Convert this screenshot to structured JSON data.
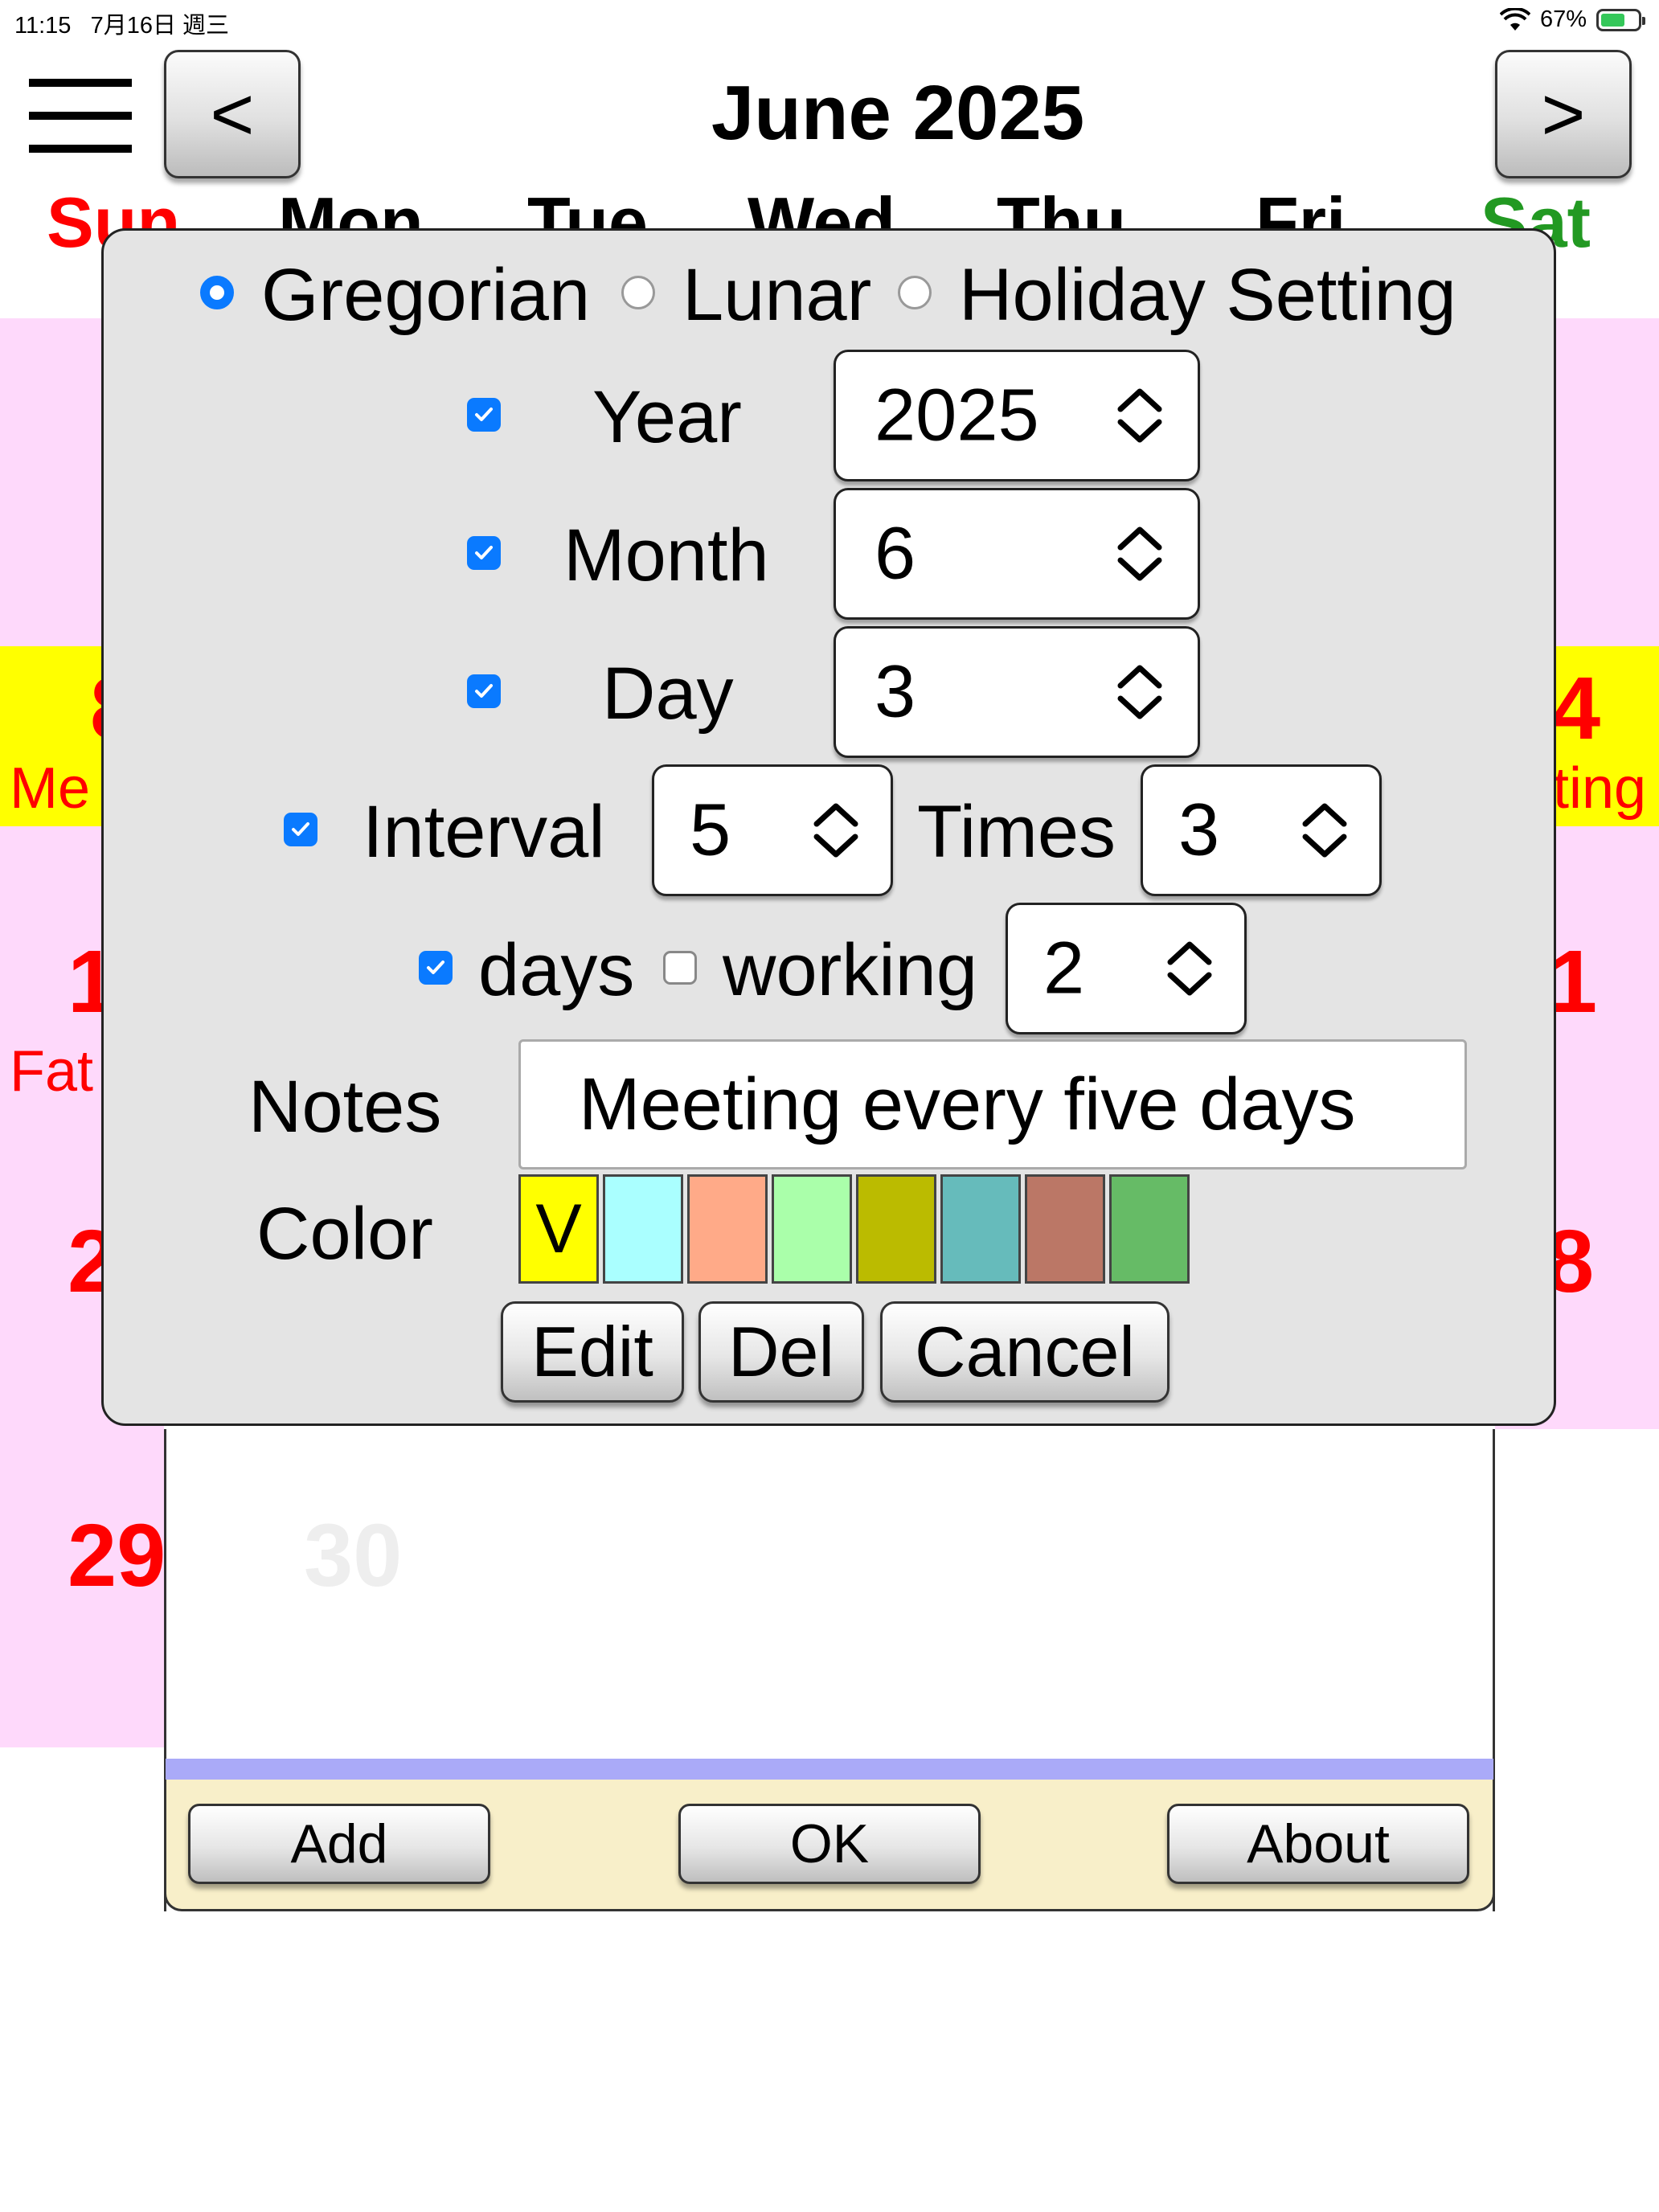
{
  "status_bar": {
    "time": "11:15",
    "date": "7月16日 週三",
    "battery": "67%"
  },
  "header": {
    "menu_icon": "hamburger-icon",
    "prev_label": "<",
    "next_label": ">",
    "title": "June 2025"
  },
  "weekdays": [
    "Sun",
    "Mon",
    "Tue",
    "Wed",
    "Thu",
    "Fri",
    "Sat"
  ],
  "calendar": {
    "row2_left_num": "8",
    "row2_left_text": "Me",
    "row2_right_num": "4",
    "row2_right_text": "ting",
    "row3_left_num": "1",
    "row3_left_text": "Fat",
    "row3_right_num": "1",
    "row4_left_num": "2",
    "row4_right_num": "8",
    "row5_sun": "29",
    "row5_mon": "30"
  },
  "dialog": {
    "mode_options": [
      "Gregorian",
      "Lunar",
      "Holiday Setting"
    ],
    "mode_selected": "Gregorian",
    "year_label": "Year",
    "year_value": "2025",
    "month_label": "Month",
    "month_value": "6",
    "day_label": "Day",
    "day_value": "3",
    "interval_label": "Interval",
    "interval_value": "5",
    "times_label": "Times",
    "times_value": "3",
    "days_label": "days",
    "working_label": "working",
    "working_value": "2",
    "notes_label": "Notes",
    "notes_value": "Meeting every five days",
    "color_label": "Color",
    "colors": [
      "#ffff00",
      "#aaffff",
      "#ffaa88",
      "#aaffaa",
      "#bbbb00",
      "#66bbbb",
      "#bb7766",
      "#66bb66"
    ],
    "selected_color_mark": "V",
    "edit_label": "Edit",
    "del_label": "Del",
    "cancel_label": "Cancel"
  },
  "bottom_bar": {
    "add_label": "Add",
    "ok_label": "OK",
    "about_label": "About"
  }
}
